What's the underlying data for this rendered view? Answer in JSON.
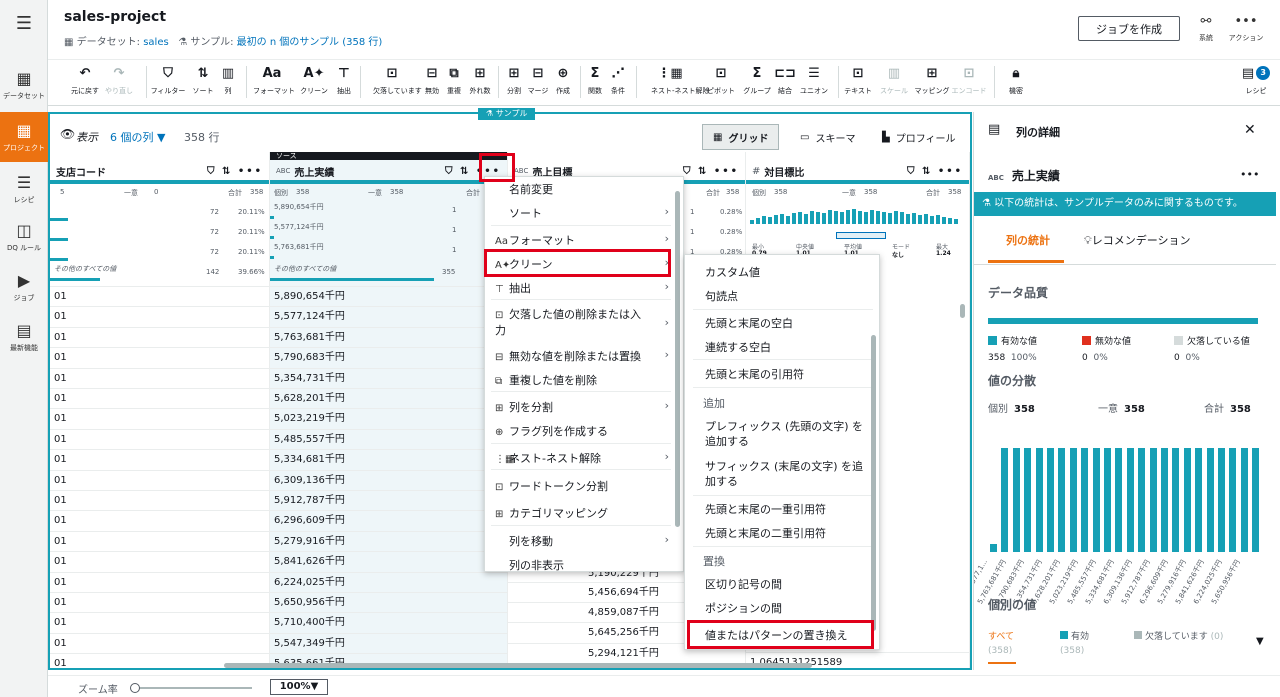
{
  "header": {
    "project_title": "sales-project",
    "dataset_label": "データセット:",
    "dataset_name": "sales",
    "sample_label": "サンプル:",
    "sample_value": "最初の n 個のサンプル (358 行)",
    "create_job": "ジョブを作成",
    "lineage": "系統",
    "actions": "アクション"
  },
  "nav": {
    "items": [
      "データセット",
      "プロジェクト",
      "レシピ",
      "DQ ルール",
      "ジョブ",
      "最新機能"
    ]
  },
  "toolbar": {
    "items": [
      "元に戻す",
      "やり直し",
      "フィルター",
      "ソート",
      "列",
      "フォーマット",
      "クリーン",
      "抽出",
      "欠落しています",
      "無効",
      "重複",
      "外れ数",
      "分割",
      "マージ",
      "作成",
      "関数",
      "条件",
      "ネスト-ネスト解除",
      "ピボット",
      "グループ",
      "結合",
      "ユニオン",
      "テキスト",
      "スケール",
      "マッピング",
      "エンコード",
      "機密",
      "レシピ"
    ],
    "recipe_count": "3"
  },
  "grid": {
    "sample_tag": "サンプル",
    "view_label": "表示",
    "column_count": "6 個の列",
    "row_count": "358 行",
    "view_tabs": [
      "グリッド",
      "スキーマ",
      "プロフィール"
    ],
    "source_label": "ソース",
    "columns": [
      {
        "name": "支店コード",
        "type": "",
        "distinct_label": "",
        "unique_label": "一意",
        "unique_value": "0",
        "total_label": "合計",
        "total_value": "358",
        "first_stat": "5"
      },
      {
        "name": "売上実績",
        "type": "ABC",
        "distinct_label": "個別",
        "distinct_value": "358",
        "unique_label": "一意",
        "unique_value": "358",
        "total_label": "合計",
        "total_value": "358"
      },
      {
        "name": "売上目標",
        "type": "ABC",
        "total_label": "合計",
        "total_value": "358"
      },
      {
        "name": "対目標比",
        "type": "#",
        "distinct_label": "個別",
        "distinct_value": "358",
        "unique_label": "一意",
        "unique_value": "358",
        "total_label": "合計",
        "total_value": "358"
      }
    ],
    "col1_profile": [
      {
        "value": "",
        "count": "72",
        "pct": "20.11%"
      },
      {
        "value": "",
        "count": "72",
        "pct": "20.11%"
      },
      {
        "value": "",
        "count": "72",
        "pct": "20.11%"
      },
      {
        "value": "その他のすべての値",
        "count": "142",
        "pct": "39.66%"
      }
    ],
    "col2_profile": [
      {
        "value": "5,890,654千円",
        "count": "1",
        "pct": ""
      },
      {
        "value": "5,577,124千円",
        "count": "1",
        "pct": ""
      },
      {
        "value": "5,763,681千円",
        "count": "1",
        "pct": ""
      },
      {
        "value": "その他のすべての値",
        "count": "355",
        "pct": ""
      }
    ],
    "col3_profile": [
      {
        "count": "1",
        "pct": "0.28%"
      },
      {
        "count": "1",
        "pct": "0.28%"
      },
      {
        "count": "1",
        "pct": "0.28%"
      }
    ],
    "box_labels": [
      "最小",
      "中央値",
      "平均値",
      "モード",
      "最大"
    ],
    "box_values": [
      "0.79",
      "1.01",
      "1.01",
      "なし",
      "1.24"
    ],
    "col1_cells": [
      "01",
      "01",
      "01",
      "01",
      "01",
      "01",
      "01",
      "01",
      "01",
      "01",
      "01",
      "01",
      "01",
      "01",
      "01",
      "01",
      "01",
      "01",
      "01"
    ],
    "col2_cells": [
      "5,890,654千円",
      "5,577,124千円",
      "5,763,681千円",
      "5,790,683千円",
      "5,354,731千円",
      "5,628,201千円",
      "5,023,219千円",
      "5,485,557千円",
      "5,334,681千円",
      "6,309,136千円",
      "5,912,787千円",
      "6,296,609千円",
      "5,279,916千円",
      "5,841,626千円",
      "6,224,025千円",
      "5,650,956千円",
      "5,710,400千円",
      "5,547,349千円",
      "5,635,661千円"
    ],
    "col3_cells": [
      "",
      "",
      "",
      "",
      "",
      "",
      "",
      "",
      "",
      "",
      "",
      "",
      "",
      "",
      "5,456,694千円",
      "4,859,087千円",
      "5,645,256千円",
      "5,294,121千円"
    ],
    "col3_partial": "5,190,229千円",
    "col4_last": "1.0645131251589"
  },
  "menu1": {
    "items": [
      "名前変更",
      "ソート",
      "フォーマット",
      "クリーン",
      "抽出",
      "欠落した値の削除または入力",
      "無効な値を削除または置換",
      "重複した値を削除",
      "列を分割",
      "フラグ列を作成する",
      "ネスト-ネスト解除",
      "ワードトークン分割",
      "カテゴリマッピング",
      "列を移動",
      "列の非表示"
    ]
  },
  "menu2": {
    "items": [
      "カスタム値",
      "句読点",
      "先頭と末尾の空白",
      "連続する空白",
      "先頭と末尾の引用符",
      "プレフィックス (先頭の文字) を追加する",
      "サフィックス (末尾の文字) を追加する",
      "先頭と末尾の一重引用符",
      "先頭と末尾の二重引用符",
      "区切り記号の間",
      "ポジションの間",
      "値またはパターンの置き換え"
    ],
    "groups": [
      "追加",
      "置換"
    ]
  },
  "rpanel": {
    "title": "列の詳細",
    "col_type": "ABC",
    "col_name": "売上実績",
    "info": "以下の統計は、サンプルデータのみに関するものです。",
    "tab_stats": "列の統計",
    "tab_reco": "レコメンデーション",
    "data_quality": "データ品質",
    "valid_label": "有効な値",
    "valid_count": "358",
    "valid_pct": "100%",
    "invalid_label": "無効な値",
    "invalid_count": "0",
    "invalid_pct": "0%",
    "missing_label": "欠落している値",
    "missing_count": "0",
    "missing_pct": "0%",
    "distribution": "値の分散",
    "distinct_label": "個別",
    "distinct_value": "358",
    "unique_label": "一意",
    "unique_value": "358",
    "total_label": "合計",
    "total_value": "358",
    "hist_ticks": [
      "5,577,1...",
      "5,763,681千円",
      "5,790,683千円",
      "5,354,731千円",
      "5,628,201千円",
      "5,023,219千円",
      "5,485,557千円",
      "5,334,681千円",
      "6,309,136千円",
      "5,912,787千円",
      "6,296,609千円",
      "5,279,916千円",
      "5,841,626千円",
      "6,224,025千円",
      "5,650,956千円"
    ],
    "distinct_values": "個別の値",
    "vt_all": "すべて",
    "vt_all_count": "(358)",
    "vt_valid": "有効",
    "vt_valid_count": "(358)",
    "vt_missing": "欠落しています",
    "vt_missing_count": "(0)"
  },
  "bottom": {
    "zoom_label": "ズーム率",
    "zoom_value": "100%"
  },
  "colors": {
    "accent": "#16a0b5",
    "nav_active": "#ec7211",
    "highlight": "#e0001a"
  }
}
